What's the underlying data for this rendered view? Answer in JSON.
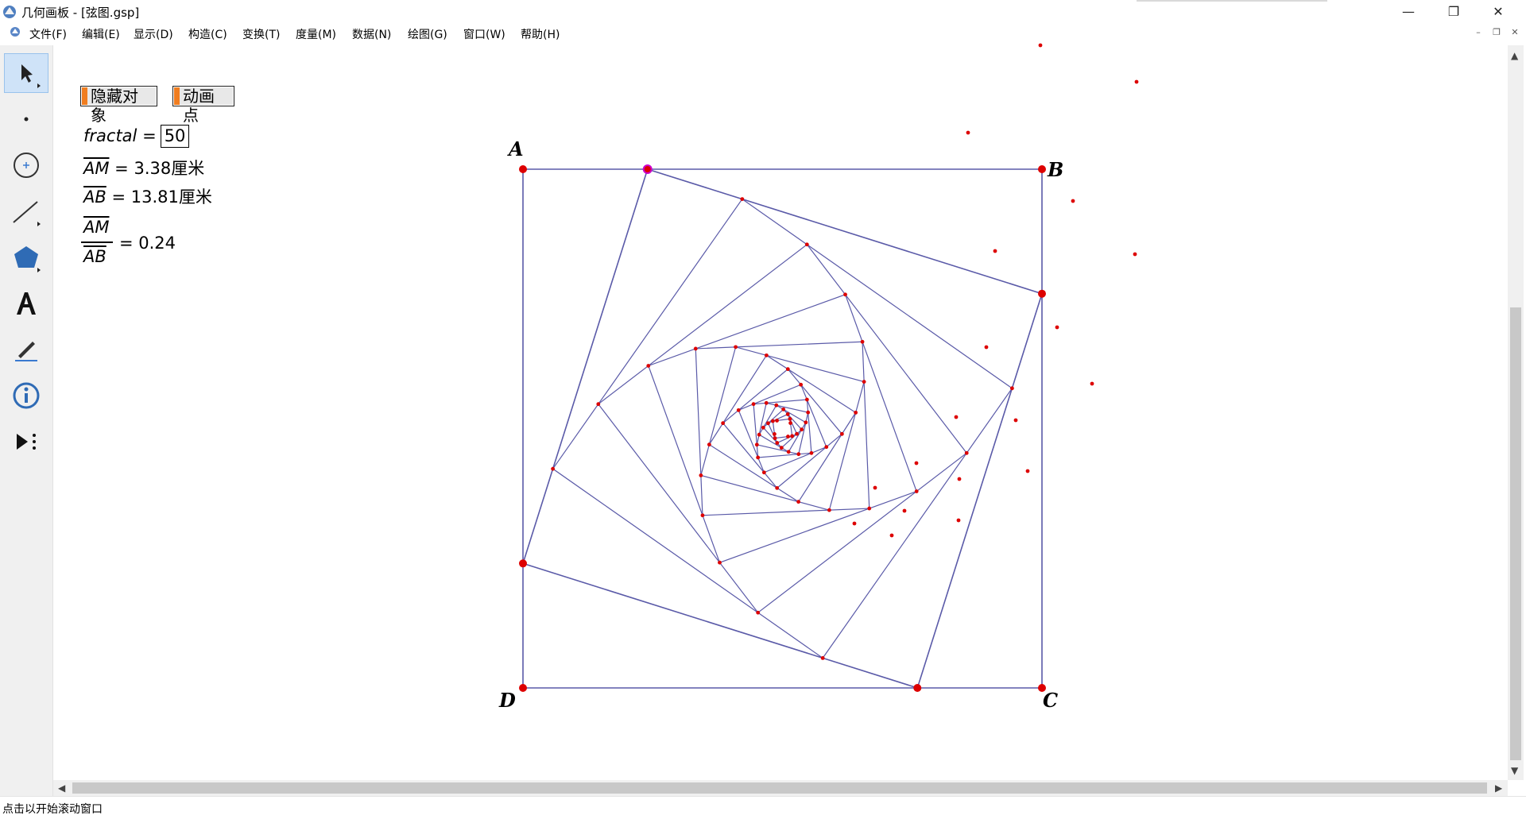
{
  "window": {
    "title": "几何画板 - [弦图.gsp]",
    "controls": {
      "minimize": "—",
      "restore": "❐",
      "close": "✕"
    }
  },
  "menu": {
    "items": [
      "文件(F)",
      "编辑(E)",
      "显示(D)",
      "构造(C)",
      "变换(T)",
      "度量(M)",
      "数据(N)",
      "绘图(G)",
      "窗口(W)",
      "帮助(H)"
    ],
    "mdi": {
      "minimize": "–",
      "restore": "❐",
      "close": "✕"
    }
  },
  "toolbox": {
    "tools": [
      "arrow-tool",
      "point-tool",
      "compass-tool",
      "straightedge-tool",
      "polygon-tool",
      "text-tool",
      "marker-tool",
      "information-tool",
      "custom-tool"
    ],
    "active": "arrow-tool"
  },
  "buttons": {
    "hide": "隐藏对象",
    "animate": "动画点"
  },
  "measurements": {
    "fractal_label": "fractal",
    "equals": "=",
    "fractal_value": "50",
    "am_label": "AM",
    "am_value": "3.38",
    "ab_label": "AB",
    "ab_value": "13.81",
    "unit": "厘米",
    "ratio_value": "= 0.24"
  },
  "points": {
    "a": "A",
    "b": "B",
    "c": "C",
    "d": "D"
  },
  "colors": {
    "lines": "#5a5aa8",
    "points": "#dd0000",
    "button_accent": "#f07d20",
    "selected_point": "#cc00cc"
  },
  "scroll": {
    "up": "▲",
    "down": "▼",
    "left": "◀",
    "right": "▶"
  },
  "status": "点击以开始滚动窗口"
}
